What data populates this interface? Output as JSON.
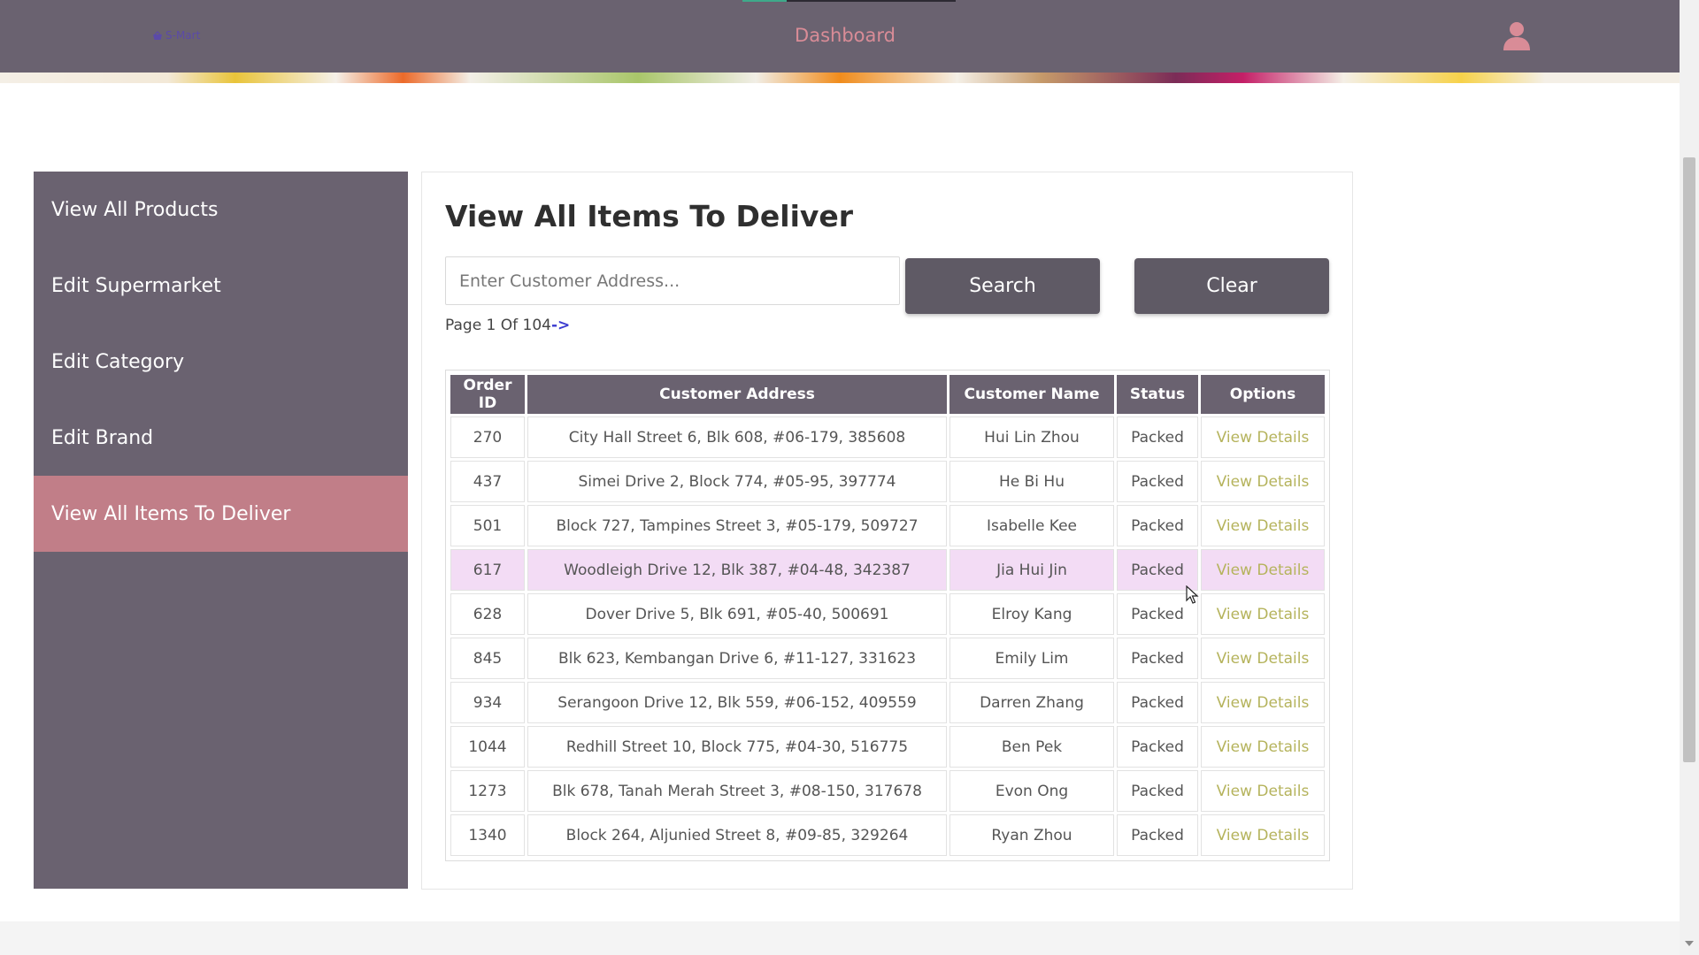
{
  "nav": {
    "brand": "S-Mart",
    "title": "Dashboard"
  },
  "sidebar": {
    "items": [
      {
        "label": "View All Products"
      },
      {
        "label": "Edit Supermarket"
      },
      {
        "label": "Edit Category"
      },
      {
        "label": "Edit Brand"
      },
      {
        "label": "View All Items To Deliver"
      }
    ],
    "active": "View All Items To Deliver"
  },
  "main": {
    "title": "View All Items To Deliver",
    "search": {
      "placeholder": "Enter Customer Address...",
      "value": ""
    },
    "search_button": "Search",
    "clear_button": "Clear",
    "pager": {
      "text": "Page 1 Of 104",
      "next": "->"
    },
    "table": {
      "headers": [
        "Order ID",
        "Customer Address",
        "Customer Name",
        "Status",
        "Options"
      ],
      "rows": [
        [
          "270",
          "City Hall Street 6, Blk 608, #06-179, 385608",
          "Hui Lin Zhou",
          "Packed",
          "View Details"
        ],
        [
          "437",
          "Simei Drive 2, Block 774, #05-95, 397774",
          "He Bi Hu",
          "Packed",
          "View Details"
        ],
        [
          "501",
          "Block 727, Tampines Street 3, #05-179, 509727",
          "Isabelle Kee",
          "Packed",
          "View Details"
        ],
        [
          "617",
          "Woodleigh Drive 12, Blk 387, #04-48, 342387",
          "Jia Hui Jin",
          "Packed",
          "View Details"
        ],
        [
          "628",
          "Dover Drive 5, Blk 691, #05-40, 500691",
          "Elroy Kang",
          "Packed",
          "View Details"
        ],
        [
          "845",
          "Blk 623, Kembangan Drive 6, #11-127, 331623",
          "Emily Lim",
          "Packed",
          "View Details"
        ],
        [
          "934",
          "Serangoon Drive 12, Blk 559, #06-152, 409559",
          "Darren Zhang",
          "Packed",
          "View Details"
        ],
        [
          "1044",
          "Redhill Street 10, Block 775, #04-30, 516775",
          "Ben Pek",
          "Packed",
          "View Details"
        ],
        [
          "1273",
          "Blk 678, Tanah Merah Street 3, #08-150, 317678",
          "Evon Ong",
          "Packed",
          "View Details"
        ],
        [
          "1340",
          "Block 264, Aljunied Street 8, #09-85, 329264",
          "Ryan Zhou",
          "Packed",
          "View Details"
        ]
      ],
      "highlighted_row": 3
    }
  },
  "colors": {
    "nav_bg": "#6a6270",
    "accent_pink": "#c17e88",
    "title_pink": "#d98c97",
    "link_olive": "#b5b35c",
    "row_highlight": "#f3dcf5"
  }
}
